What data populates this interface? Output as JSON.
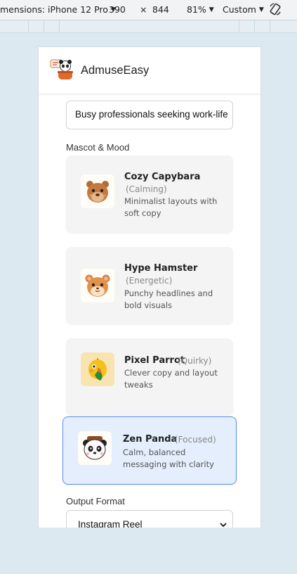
{
  "devtools": {
    "device": "mensions: iPhone 12 Pro",
    "width": "390",
    "times": "×",
    "height": "844",
    "zoom": "81%",
    "throttle": "Custom"
  },
  "app": {
    "title": "AdmuseEasy"
  },
  "audience": {
    "value": "Busy professionals seeking work-life"
  },
  "mascot": {
    "label": "Mascot & Mood",
    "options": [
      {
        "name": "Cozy Capybara",
        "mood": "(Calming)",
        "desc": "Minimalist layouts with soft copy",
        "icon": "capybara-icon"
      },
      {
        "name": "Hype Hamster",
        "mood": "(Energetic)",
        "desc": "Punchy headlines and bold visuals",
        "icon": "hamster-icon"
      },
      {
        "name": "Pixel Parrot",
        "mood": "(Quirky)",
        "desc": "Clever copy and layout tweaks",
        "icon": "parrot-icon"
      },
      {
        "name": "Zen Panda",
        "mood": "(Focused)",
        "desc": "Calm, balanced messaging with clarity",
        "icon": "panda-icon"
      }
    ],
    "selected": "Zen Panda"
  },
  "output": {
    "label": "Output Format",
    "selected": "Instagram Reel"
  },
  "colors": {
    "selected_border": "#5b8fe8",
    "selected_bg": "#e4eefd",
    "card_bg": "#f4f4f4",
    "page_bg": "#dce9f0"
  }
}
